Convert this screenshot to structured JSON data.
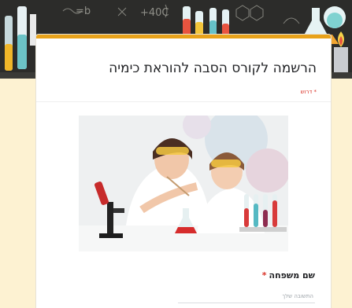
{
  "form": {
    "title": "הרשמה לקורס הסבה להוראת כימיה",
    "required_note": "* דרוש",
    "header_image": "chalkboard-lab-banner",
    "hero_image": "mother-and-child-chemistry-experiment",
    "accent_color": "#e8a21a",
    "background_color": "#fdf2d2"
  },
  "fields": [
    {
      "label": "שם משפחה",
      "required_marker": "*",
      "placeholder": "התשובה שלך"
    }
  ]
}
